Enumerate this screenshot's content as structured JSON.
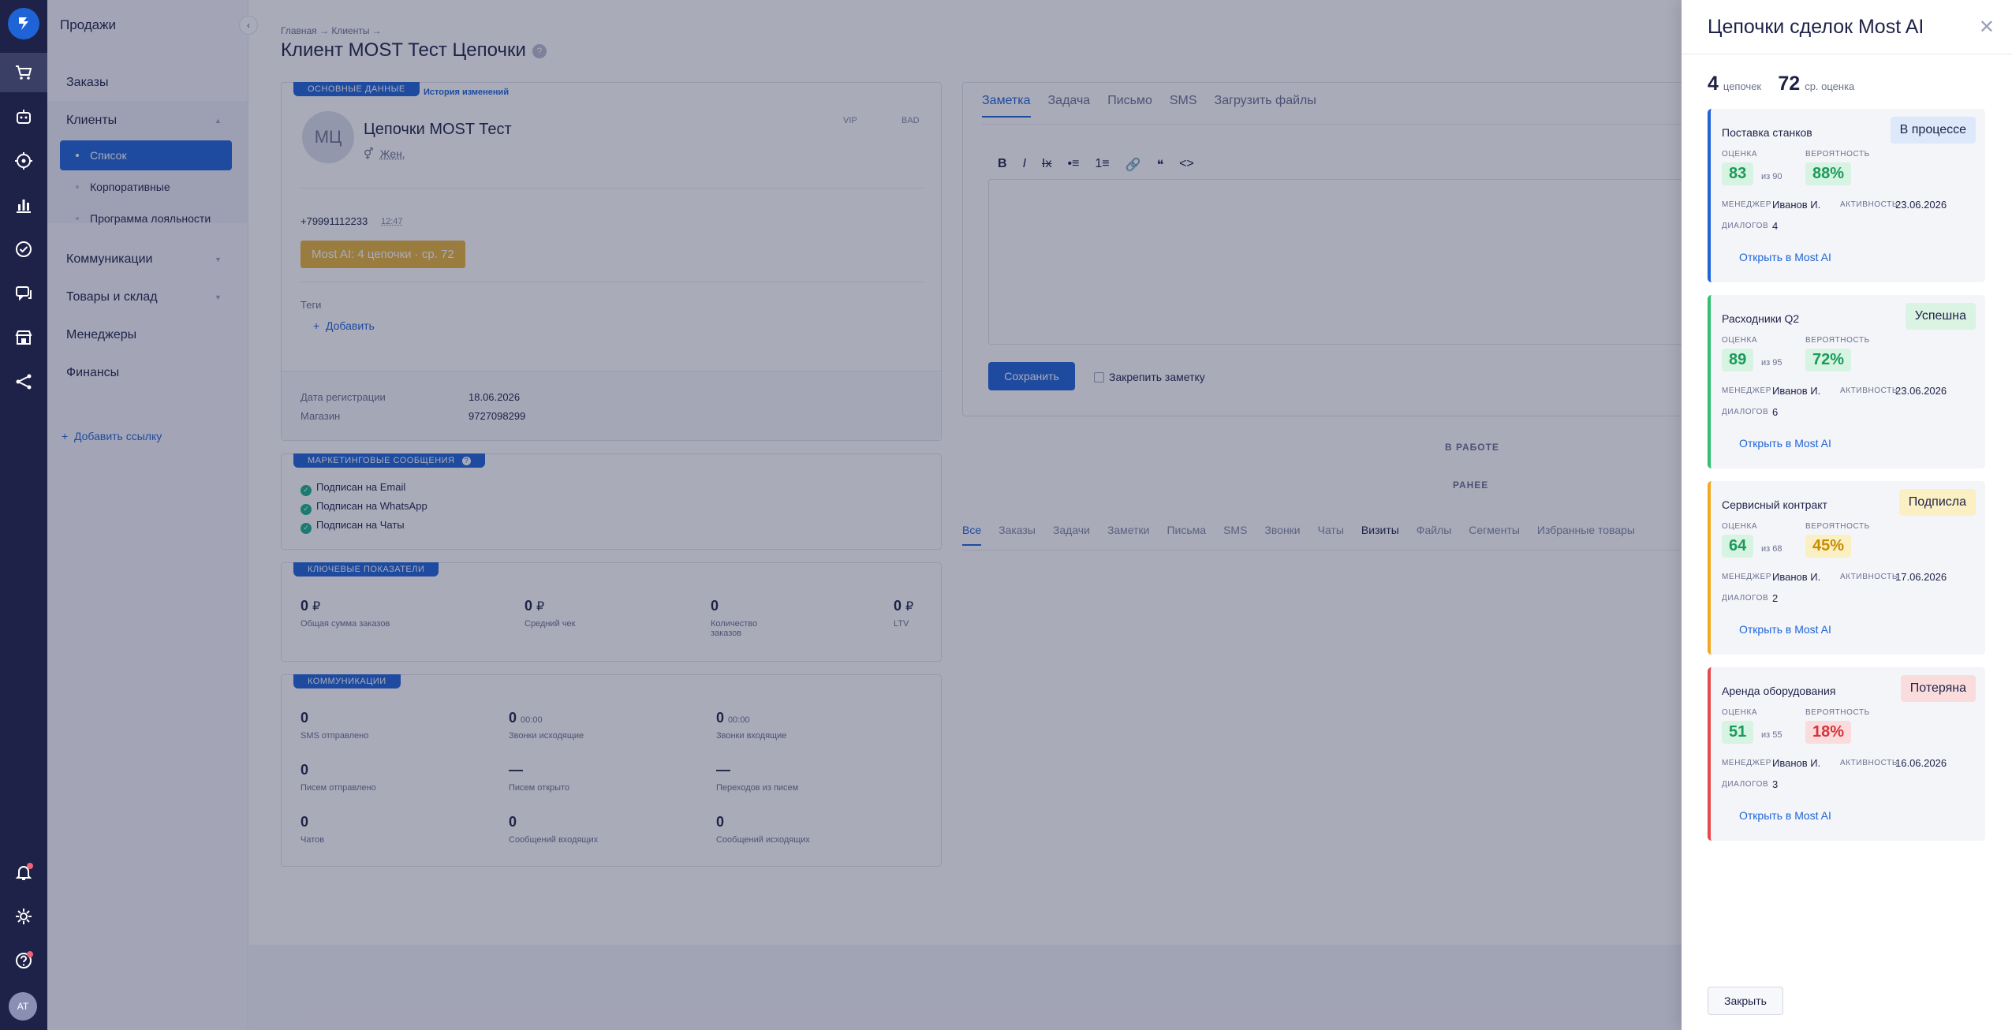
{
  "sidebar": {
    "title": "Продажи",
    "items": [
      {
        "label": "Заказы"
      },
      {
        "label": "Клиенты"
      },
      {
        "label": "Коммуникации"
      },
      {
        "label": "Товары и склад"
      },
      {
        "label": "Менеджеры"
      },
      {
        "label": "Финансы"
      }
    ],
    "clients_sub": [
      {
        "label": "Список",
        "active": true
      },
      {
        "label": "Корпоративные"
      },
      {
        "label": "Программа лояльности"
      }
    ],
    "add_link": "Добавить ссылку"
  },
  "rail": {
    "icons": [
      "logo-icon",
      "cart-icon",
      "robot-icon",
      "target-icon",
      "chart-icon",
      "check-circle-icon",
      "chat-icon",
      "store-icon",
      "share-icon",
      "bell-icon",
      "settings-icon",
      "help-icon"
    ],
    "avatar_initials": "AT"
  },
  "page": {
    "breadcrumb": "Главная → Клиенты →",
    "title": "Клиент MOST Тест Цепочки",
    "help": "?"
  },
  "main_card": {
    "tag": "ОСНОВНЫЕ ДАННЫЕ",
    "history_link": "История изменений",
    "avatar": "МЦ",
    "name": "Цепочки MOST Тест",
    "gender": "Жен.",
    "vip": "VIP",
    "bad": "BAD",
    "phone": "+79991112233",
    "phone_time": "12:47",
    "ai_badge": "Most AI: 4 цепочки · ср. 72",
    "tags_label": "Теги",
    "add_tag": "Добавить",
    "reg_label": "Дата регистрации",
    "reg_value": "18.06.2026",
    "shop_label": "Магазин",
    "shop_value": "9727098299"
  },
  "marketing": {
    "tag": "МАРКЕТИНГОВЫЕ СООБЩЕНИЯ",
    "items": [
      "Подписан на Email",
      "Подписан на WhatsApp",
      "Подписан на Чаты"
    ]
  },
  "kpi": {
    "tag": "КЛЮЧЕВЫЕ ПОКАЗАТЕЛИ",
    "items": [
      {
        "value": "0",
        "unit": "₽",
        "label": "Общая сумма заказов"
      },
      {
        "value": "0",
        "unit": "₽",
        "label": "Средний чек"
      },
      {
        "value": "0",
        "unit": "",
        "label": "Количество заказов"
      },
      {
        "value": "0",
        "unit": "₽",
        "label": "LTV"
      }
    ]
  },
  "comms": {
    "tag": "КОММУНИКАЦИИ",
    "items": [
      {
        "value": "0",
        "extra": "",
        "label": "SMS отправлено"
      },
      {
        "value": "0",
        "extra": "00:00",
        "label": "Звонки исходящие"
      },
      {
        "value": "0",
        "extra": "00:00",
        "label": "Звонки входящие"
      },
      {
        "value": "0",
        "extra": "",
        "label": "Писем отправлено"
      },
      {
        "value": "—",
        "extra": "",
        "label": "Писем открыто"
      },
      {
        "value": "—",
        "extra": "",
        "label": "Переходов из писем"
      },
      {
        "value": "0",
        "extra": "",
        "label": "Чатов"
      },
      {
        "value": "0",
        "extra": "",
        "label": "Сообщений входящих"
      },
      {
        "value": "0",
        "extra": "",
        "label": "Сообщений исходящих"
      }
    ]
  },
  "note": {
    "tabs": [
      "Заметка",
      "Задача",
      "Письмо",
      "SMS",
      "Загрузить файлы"
    ],
    "toolbar": [
      "B",
      "I",
      "Ix",
      "•≡",
      "1≡",
      "🔗",
      "❝",
      "<>"
    ],
    "save": "Сохранить",
    "pin": "Закрепить заметку"
  },
  "in_work": "В РАБОТЕ",
  "earlier": "РАНЕЕ",
  "filter_tabs": [
    "Все",
    "Заказы",
    "Задачи",
    "Заметки",
    "Письма",
    "SMS",
    "Звонки",
    "Чаты",
    "Визиты",
    "Файлы",
    "Сегменты",
    "Избранные товары"
  ],
  "drawer": {
    "title": "Цепочки сделок Most AI",
    "close": "✕",
    "chains_count": "4",
    "chains_label": "цепочек",
    "avg_score": "72",
    "avg_label": "ср. оценка",
    "score_label": "ОЦЕНКА",
    "prob_label": "ВЕРОЯТНОСТЬ",
    "manager_label": "МЕНЕДЖЕР",
    "activity_label": "АКТИВНОСТЬ",
    "dialogs_label": "ДИАЛОГОВ",
    "deals": [
      {
        "name": "Поставка станков",
        "status": "В процессе",
        "score": "83",
        "of": "из 90",
        "prob": "88%",
        "manager": "Иванов И.",
        "activity": "23.06.2026",
        "dialogs": "4",
        "link": "Открыть в Most AI",
        "accent": "#1f64d6",
        "status_bg": "#dde8fb",
        "status_fg": "#1e2248",
        "prob_color": "#1a9a5a",
        "prob_bg": "#d7f3e2"
      },
      {
        "name": "Расходники Q2",
        "status": "Успешна",
        "score": "89",
        "of": "из 95",
        "prob": "72%",
        "manager": "Иванов И.",
        "activity": "23.06.2026",
        "dialogs": "6",
        "link": "Открыть в Most AI",
        "accent": "#2fbf6f",
        "status_bg": "#dbf3e3",
        "status_fg": "#1e2248",
        "prob_color": "#1a9a5a",
        "prob_bg": "#d7f3e2"
      },
      {
        "name": "Сервисный контракт",
        "status": "Подписла",
        "score": "64",
        "of": "из 68",
        "prob": "45%",
        "manager": "Иванов И.",
        "activity": "17.06.2026",
        "dialogs": "2",
        "link": "Открыть в Most AI",
        "accent": "#f2a81d",
        "status_bg": "#fbefc4",
        "status_fg": "#1e2248",
        "prob_color": "#c98b00",
        "prob_bg": "#fbefc4"
      },
      {
        "name": "Аренда оборудования",
        "status": "Потеряна",
        "score": "51",
        "of": "из 55",
        "prob": "18%",
        "manager": "Иванов И.",
        "activity": "16.06.2026",
        "dialogs": "3",
        "link": "Открыть в Most AI",
        "accent": "#e5484d",
        "status_bg": "#fbdcdc",
        "status_fg": "#1e2248",
        "prob_color": "#d8323a",
        "prob_bg": "#fbdcdc"
      }
    ],
    "footer_close": "Закрыть"
  }
}
